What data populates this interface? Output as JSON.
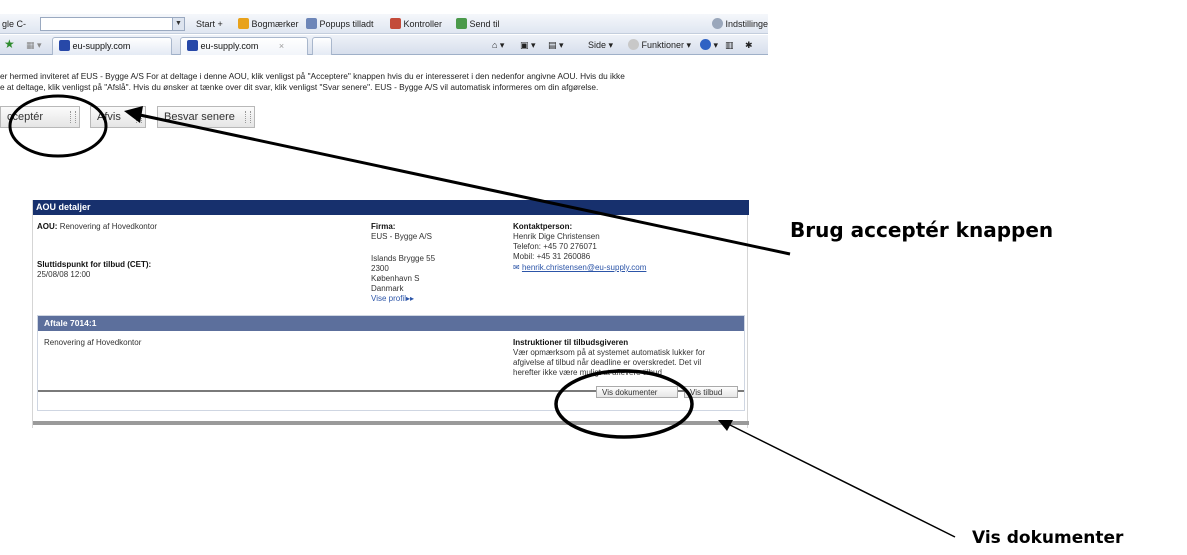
{
  "browser": {
    "address_text": "gle C-",
    "toolbar_items": [
      "Start",
      "Bogmærker",
      "Popups tilladt",
      "Kontroller",
      "Send til",
      "Indstillinger"
    ],
    "tabs": [
      {
        "label": "eu-supply.com"
      },
      {
        "label": "eu-supply.com"
      }
    ],
    "command_items": [
      "Side",
      "Funktioner"
    ]
  },
  "intro": {
    "line1": "er hermed inviteret af  EUS - Bygge A/S  For at deltage i denne AOU, klik venligst på \"Acceptere\" knappen hvis du er interesseret i den nedenfor angivne AOU. Hvis du ikke",
    "line2": "e at deltage, klik venligst på \"Afslå\". Hvis du ønsker at tænke over dit svar, klik venligst \"Svar senere\".  EUS - Bygge A/S  vil automatisk informeres om din afgørelse."
  },
  "actions": {
    "accept_label": "cceptér",
    "decline_label": "Afvis",
    "later_label": "Besvar senere"
  },
  "panel": {
    "title": "AOU detaljer",
    "aou_label": "AOU:",
    "aou_value": "Renovering af Hovedkontor",
    "deadline_label": "Sluttidspunkt for tilbud (CET):",
    "deadline_value": "25/08/08 12:00",
    "firm_label": "Firma:",
    "firm_name": "EUS - Bygge A/S",
    "address": [
      "Islands Brygge 55",
      "2300",
      "København S",
      "Danmark"
    ],
    "profile_link": "Vise profil",
    "contact_label": "Kontaktperson:",
    "contact_name": "Henrik Dige Christensen",
    "contact_phone": "Telefon: +45 70 276071",
    "contact_mobile": "Mobil: +45 31 260086",
    "contact_email": "henrik.christensen@eu-supply.com"
  },
  "agreement": {
    "title": "Aftale 7014:1",
    "description": "Renovering af Hovedkontor",
    "instr_label": "Instruktioner til tilbudsgiveren",
    "instr_lines": [
      "Vær opmærksom på at systemet automatisk lukker for",
      "afgivelse af tilbud når deadline er overskredet. Det vil",
      "herefter ikke være muligt at aflevere tilbud"
    ],
    "docs_button": "Vis dokumenter",
    "other_button": "Vis tilbud"
  },
  "annotations": {
    "accept_callout": "Brug acceptér knappen",
    "docs_callout": "Vis dokumenter"
  }
}
